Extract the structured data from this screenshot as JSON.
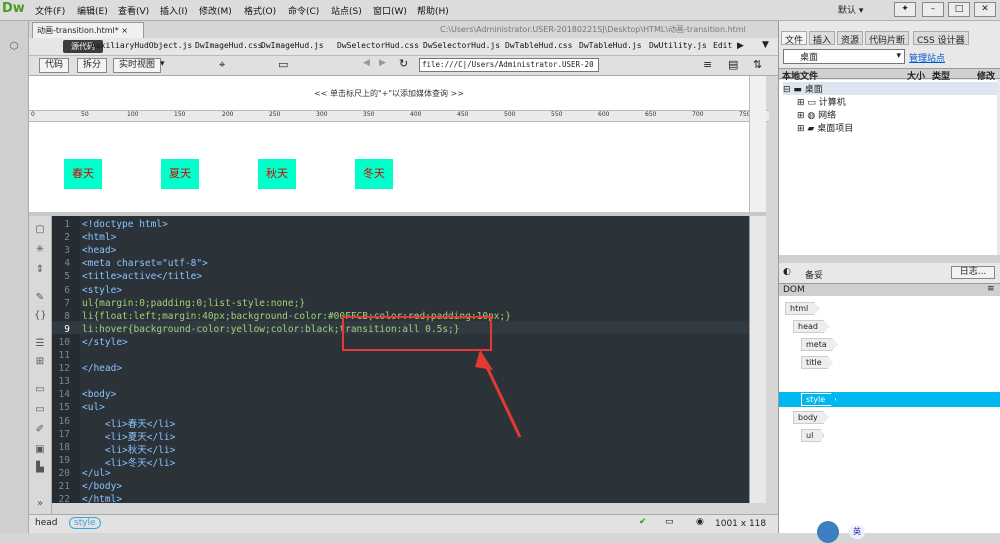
{
  "app": {
    "logo": "Dw"
  },
  "menu": [
    "文件(F)",
    "编辑(E)",
    "查看(V)",
    "插入(I)",
    "修改(M)",
    "格式(O)",
    "命令(C)",
    "站点(S)",
    "窗口(W)",
    "帮助(H)"
  ],
  "layout_mode": "默认 ▾",
  "doc_tab": "动画-transition.html* ×",
  "doc_path": "C:\\Users\\Administrator.USER-20180221SJ\\Desktop\\HTML\\动画-transition.html",
  "files_bar": {
    "source_label": "源代码",
    "files": [
      "AuxiliaryHudObject.js",
      "DwImageHud.css",
      "DwImageHud.js",
      "DwSelectorHud.css",
      "DwSelectorHud.js",
      "DwTableHud.css",
      "DwTableHud.js",
      "DwUtility.js",
      "Edit"
    ]
  },
  "toolbar": {
    "code": "代码",
    "split": "拆分",
    "live": "实时视图",
    "url": "file:///C|/Users/Administrator.USER-20"
  },
  "design": {
    "media_hint": "<< 单击标尺上的\"+\"以添加媒体查询 >>",
    "ruler_ticks": [
      "0",
      "50",
      "100",
      "150",
      "200",
      "250",
      "300",
      "350",
      "400",
      "450",
      "500",
      "550",
      "600",
      "650",
      "700",
      "750"
    ],
    "items": [
      "春天",
      "夏天",
      "秋天",
      "冬天"
    ]
  },
  "code": {
    "line_numbers": [
      "1",
      "2",
      "3",
      "4",
      "5",
      "6",
      "7",
      "8",
      "9",
      "10",
      "11",
      "12",
      "13",
      "14",
      "15",
      "16",
      "17",
      "18",
      "19",
      "20",
      "21",
      "22"
    ],
    "lines": [
      "<!doctype html>",
      "<html>",
      "<head>",
      "<meta charset=\"utf-8\">",
      "<title>active</title>",
      "<style>",
      "ul{margin:0;padding:0;list-style:none;}",
      "li{float:left;margin:40px;background-color:#00FFCB;color:red;padding:10px;}",
      "li:hover{background-color:yellow;color:black;transition:all 0.5s;}",
      "</style>",
      "",
      "</head>",
      "",
      "<body>",
      "<ul>",
      "    <li>春天</li>",
      "    <li>夏天</li>",
      "    <li>秋天</li>",
      "    <li>冬天</li>",
      "</ul>",
      "</body>",
      "</html>"
    ]
  },
  "status": {
    "tag1": "head",
    "tag2": "style",
    "size": "1001 x 118"
  },
  "right_panel": {
    "tabs": [
      "文件",
      "插入",
      "资源",
      "代码片断",
      "CSS 设计器"
    ],
    "site": "桌面",
    "manage": "管理站点",
    "cols": [
      "本地文件",
      "大小",
      "类型",
      "修改"
    ],
    "tree": [
      "桌面",
      "计算机",
      "网络",
      "桌面项目"
    ],
    "ready": "备妥",
    "log": "日志...",
    "dom_title": "DOM",
    "dom_nodes": [
      "html",
      "head",
      "meta",
      "title",
      "style",
      "body",
      "ul"
    ],
    "lang": "英"
  },
  "annotation_color": "#e53935",
  "highlight_text": "transition:all 0.5s;}"
}
